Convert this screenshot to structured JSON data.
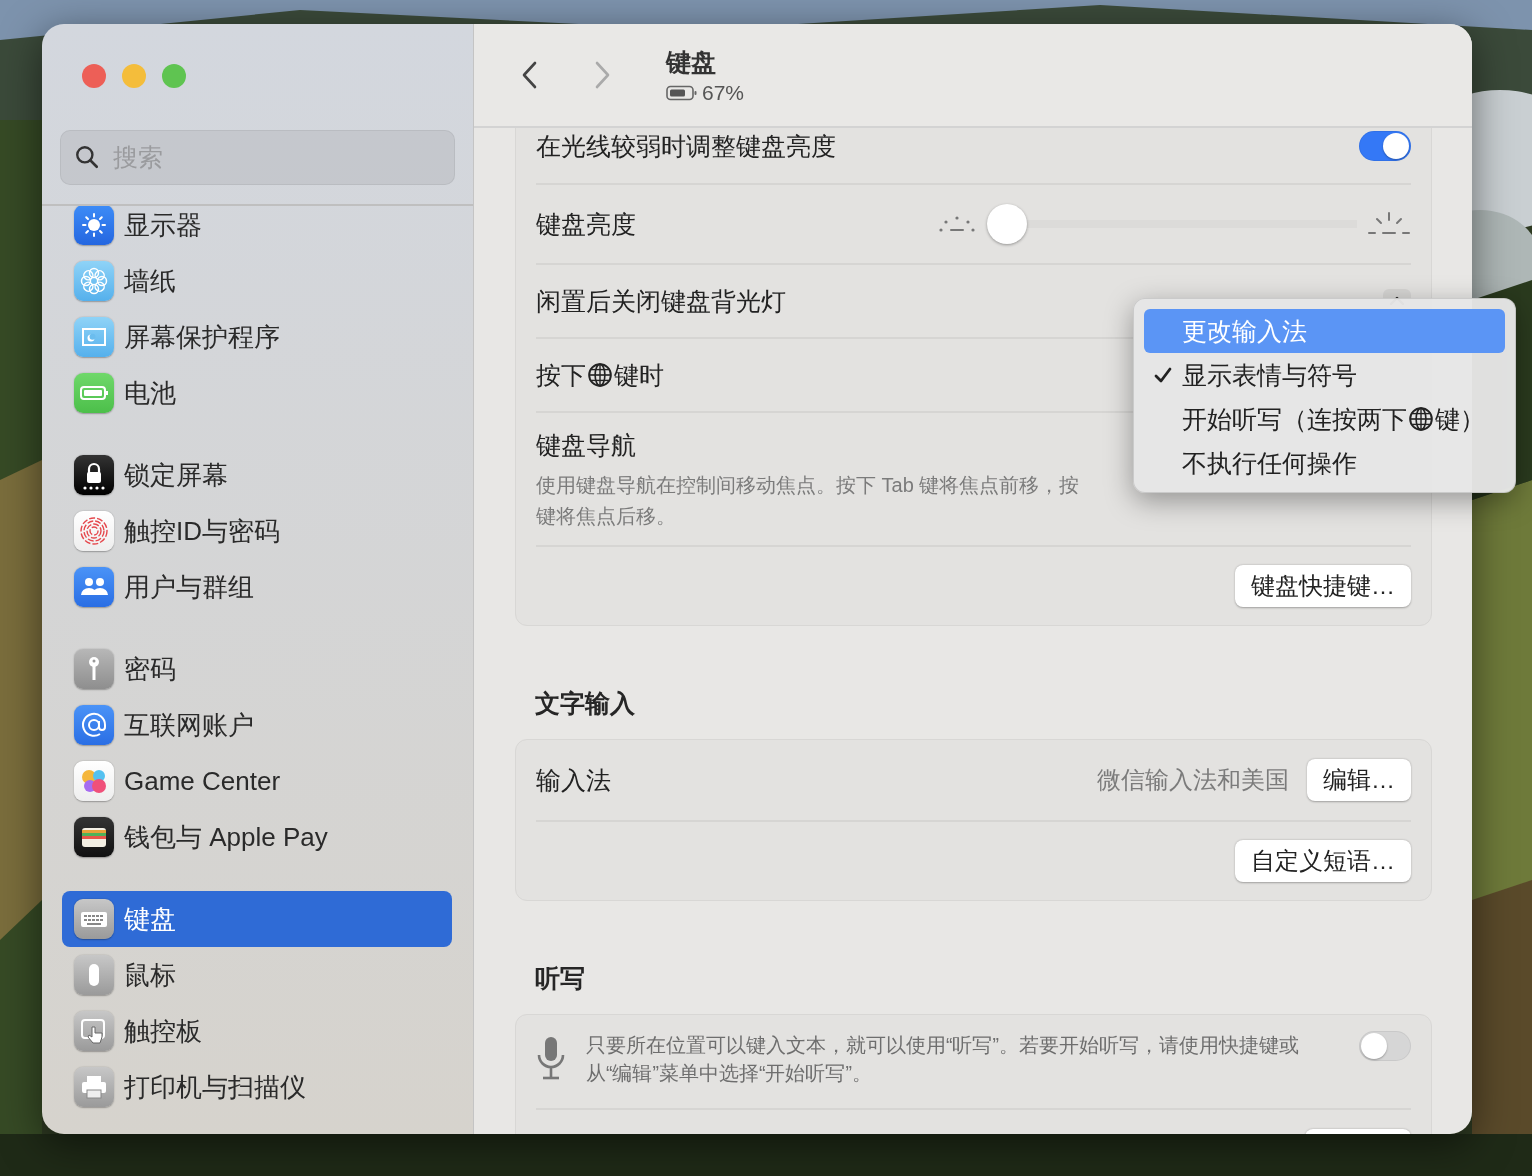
{
  "window": {
    "title": "键盘",
    "subtitle": "67%"
  },
  "sidebar": {
    "search": {
      "placeholder": "搜索"
    },
    "groups": [
      [
        {
          "kind": "display",
          "label": "显示器",
          "selected": false
        },
        {
          "kind": "wallpaper",
          "label": "墙纸",
          "selected": false
        },
        {
          "kind": "screensaver",
          "label": "屏幕保护程序",
          "selected": false
        },
        {
          "kind": "battery",
          "label": "电池",
          "selected": false
        }
      ],
      [
        {
          "kind": "lock",
          "label": "锁定屏幕",
          "selected": false
        },
        {
          "kind": "touchid",
          "label": "触控ID与密码",
          "selected": false
        },
        {
          "kind": "users",
          "label": "用户与群组",
          "selected": false
        }
      ],
      [
        {
          "kind": "passwords",
          "label": "密码",
          "selected": false
        },
        {
          "kind": "internet",
          "label": "互联网账户",
          "selected": false
        },
        {
          "kind": "gamecenter",
          "label": "Game Center",
          "selected": false
        },
        {
          "kind": "wallet",
          "label": "钱包与 Apple Pay",
          "selected": false
        }
      ],
      [
        {
          "kind": "keyboard",
          "label": "键盘",
          "selected": true
        },
        {
          "kind": "mouse",
          "label": "鼠标",
          "selected": false
        },
        {
          "kind": "trackpad",
          "label": "触控板",
          "selected": false
        },
        {
          "kind": "printer",
          "label": "打印机与扫描仪",
          "selected": false
        }
      ]
    ]
  },
  "sections": [
    {
      "rows": [
        {
          "kind": "toggle",
          "label": "在光线较弱时调整键盘亮度",
          "on": true
        },
        {
          "kind": "slider",
          "label": "键盘亮度",
          "level": 0
        },
        {
          "kind": "popup",
          "label": "闲置后关闭键盘背光灯"
        },
        {
          "kind": "globe",
          "label": "按下",
          "label_after": "键时"
        },
        {
          "kind": "description",
          "label": "键盘导航",
          "lines": [
            "使用键盘导航在控制间移动焦点。按下 Tab 键将焦点前移，按",
            "键将焦点后移。"
          ]
        },
        {
          "kind": "button",
          "button": "键盘快捷键…"
        }
      ]
    },
    {
      "title": "文字输入",
      "rows": [
        {
          "kind": "value",
          "label": "输入法",
          "value": "微信输入法和美国",
          "button": "编辑…"
        },
        {
          "kind": "button",
          "button": "自定义短语…"
        }
      ]
    },
    {
      "title": "听写",
      "rows": [
        {
          "kind": "mic",
          "text": "只要所在位置可以键入文本，就可以使用“听写”。若要开始听写，请使用快捷键或从“编辑”菜单中选择“开始听写”。",
          "on": false
        },
        {
          "kind": "cut"
        }
      ]
    }
  ],
  "menu": {
    "items": [
      {
        "label": "更改输入法",
        "selected": true,
        "checked": false
      },
      {
        "label": "显示表情与符号",
        "selected": false,
        "checked": true
      },
      {
        "label": "开始听写（连按两下",
        "label_after": "键）",
        "selected": false,
        "checked": false
      },
      {
        "label": "不执行任何操作",
        "selected": false,
        "checked": false
      }
    ]
  }
}
